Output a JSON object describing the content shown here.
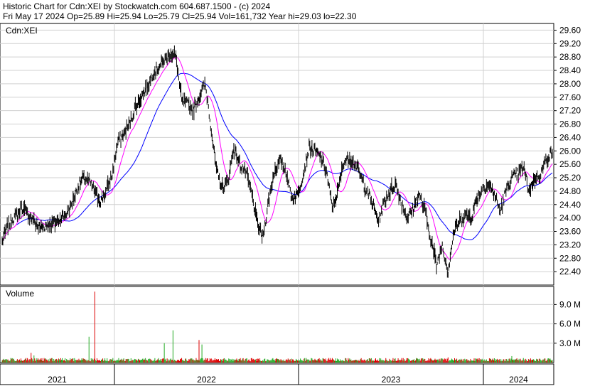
{
  "header": {
    "line1": "Historic Chart for Cdn:XEI by Stockwatch.com 604.687.1500 - (c) 2024",
    "line2": "Fri May 17 2024   Op=25.89  Hi=25.94  Lo=25.79  Cl=25.94  Vol=161,732  Year hi=29.03  lo=22.30"
  },
  "chart_data": {
    "type": "line",
    "symbol_label": "Cdn:XEI",
    "price_axis": {
      "ticks": [
        "29.60",
        "29.20",
        "28.80",
        "28.40",
        "28.00",
        "27.60",
        "27.20",
        "26.80",
        "26.40",
        "26.00",
        "25.60",
        "25.20",
        "24.80",
        "24.40",
        "24.00",
        "23.60",
        "23.20",
        "22.80",
        "22.40"
      ],
      "ylim": [
        22.0,
        29.8
      ]
    },
    "volume_axis": {
      "label": "Volume",
      "ticks": [
        "9.0 M",
        "6.0 M",
        "3.0 M"
      ],
      "ylim": [
        0,
        11.8
      ]
    },
    "time_axis": {
      "labels": [
        "2021",
        "2022",
        "2023",
        "2024"
      ]
    },
    "series": [
      {
        "role": "price",
        "color": "#000000"
      },
      {
        "role": "short-ma",
        "color": "#ff00ff"
      },
      {
        "role": "long-ma",
        "color": "#0000ff"
      }
    ],
    "price_keypoints": [
      {
        "t": 0,
        "v": 23.3
      },
      {
        "t": 2,
        "v": 23.8
      },
      {
        "t": 4,
        "v": 24.0
      },
      {
        "t": 7,
        "v": 24.3
      },
      {
        "t": 10,
        "v": 24.0
      },
      {
        "t": 13,
        "v": 23.7
      },
      {
        "t": 16,
        "v": 23.8
      },
      {
        "t": 19,
        "v": 23.9
      },
      {
        "t": 22,
        "v": 24.1
      },
      {
        "t": 24,
        "v": 24.4
      },
      {
        "t": 26,
        "v": 24.9
      },
      {
        "t": 28,
        "v": 25.2
      },
      {
        "t": 30,
        "v": 25.1
      },
      {
        "t": 32,
        "v": 24.8
      },
      {
        "t": 34,
        "v": 24.5
      },
      {
        "t": 36,
        "v": 24.8
      },
      {
        "t": 38,
        "v": 25.3
      },
      {
        "t": 40,
        "v": 26.3
      },
      {
        "t": 42,
        "v": 26.5
      },
      {
        "t": 44,
        "v": 26.8
      },
      {
        "t": 46,
        "v": 27.3
      },
      {
        "t": 48,
        "v": 27.6
      },
      {
        "t": 50,
        "v": 27.9
      },
      {
        "t": 52,
        "v": 28.3
      },
      {
        "t": 54,
        "v": 28.5
      },
      {
        "t": 56,
        "v": 28.7
      },
      {
        "t": 58,
        "v": 28.9
      },
      {
        "t": 60,
        "v": 28.8
      },
      {
        "t": 62,
        "v": 27.5
      },
      {
        "t": 64,
        "v": 27.4
      },
      {
        "t": 66,
        "v": 27.2
      },
      {
        "t": 68,
        "v": 27.6
      },
      {
        "t": 70,
        "v": 28.0
      },
      {
        "t": 71,
        "v": 27.5
      },
      {
        "t": 72,
        "v": 26.8
      },
      {
        "t": 74,
        "v": 25.4
      },
      {
        "t": 76,
        "v": 24.9
      },
      {
        "t": 78,
        "v": 25.1
      },
      {
        "t": 80,
        "v": 26.1
      },
      {
        "t": 82,
        "v": 25.6
      },
      {
        "t": 84,
        "v": 25.4
      },
      {
        "t": 86,
        "v": 24.8
      },
      {
        "t": 88,
        "v": 23.9
      },
      {
        "t": 90,
        "v": 23.4
      },
      {
        "t": 92,
        "v": 24.5
      },
      {
        "t": 94,
        "v": 25.4
      },
      {
        "t": 96,
        "v": 25.7
      },
      {
        "t": 98,
        "v": 25.4
      },
      {
        "t": 100,
        "v": 24.6
      },
      {
        "t": 102,
        "v": 24.7
      },
      {
        "t": 104,
        "v": 25.3
      },
      {
        "t": 106,
        "v": 26.1
      },
      {
        "t": 108,
        "v": 26.0
      },
      {
        "t": 110,
        "v": 25.8
      },
      {
        "t": 112,
        "v": 25.4
      },
      {
        "t": 114,
        "v": 24.3
      },
      {
        "t": 116,
        "v": 24.8
      },
      {
        "t": 118,
        "v": 25.7
      },
      {
        "t": 120,
        "v": 25.8
      },
      {
        "t": 122,
        "v": 25.6
      },
      {
        "t": 124,
        "v": 25.2
      },
      {
        "t": 126,
        "v": 24.8
      },
      {
        "t": 128,
        "v": 24.4
      },
      {
        "t": 130,
        "v": 23.9
      },
      {
        "t": 132,
        "v": 24.5
      },
      {
        "t": 134,
        "v": 24.8
      },
      {
        "t": 136,
        "v": 25.0
      },
      {
        "t": 138,
        "v": 24.4
      },
      {
        "t": 140,
        "v": 24.0
      },
      {
        "t": 142,
        "v": 24.3
      },
      {
        "t": 144,
        "v": 24.7
      },
      {
        "t": 146,
        "v": 24.2
      },
      {
        "t": 148,
        "v": 23.4
      },
      {
        "t": 150,
        "v": 22.6
      },
      {
        "t": 152,
        "v": 23.2
      },
      {
        "t": 154,
        "v": 22.4
      },
      {
        "t": 156,
        "v": 23.6
      },
      {
        "t": 158,
        "v": 23.9
      },
      {
        "t": 160,
        "v": 24.1
      },
      {
        "t": 162,
        "v": 24.0
      },
      {
        "t": 164,
        "v": 24.6
      },
      {
        "t": 166,
        "v": 24.9
      },
      {
        "t": 168,
        "v": 25.0
      },
      {
        "t": 170,
        "v": 24.7
      },
      {
        "t": 172,
        "v": 24.2
      },
      {
        "t": 174,
        "v": 24.8
      },
      {
        "t": 176,
        "v": 25.2
      },
      {
        "t": 178,
        "v": 25.3
      },
      {
        "t": 180,
        "v": 25.5
      },
      {
        "t": 182,
        "v": 24.8
      },
      {
        "t": 184,
        "v": 25.2
      },
      {
        "t": 186,
        "v": 25.3
      },
      {
        "t": 188,
        "v": 25.8
      },
      {
        "t": 190,
        "v": 25.94
      }
    ],
    "volume_spikes_millions": [
      {
        "t": 4,
        "v": 0.6
      },
      {
        "t": 10,
        "v": 1.5
      },
      {
        "t": 11,
        "v": 1.1
      },
      {
        "t": 30,
        "v": 4.0
      },
      {
        "t": 32,
        "v": 11.0
      },
      {
        "t": 56,
        "v": 3.0
      },
      {
        "t": 59,
        "v": 5.0
      },
      {
        "t": 68,
        "v": 3.5
      },
      {
        "t": 69,
        "v": 2.8
      },
      {
        "t": 154,
        "v": 0.8
      },
      {
        "t": 176,
        "v": 1.0
      }
    ]
  }
}
